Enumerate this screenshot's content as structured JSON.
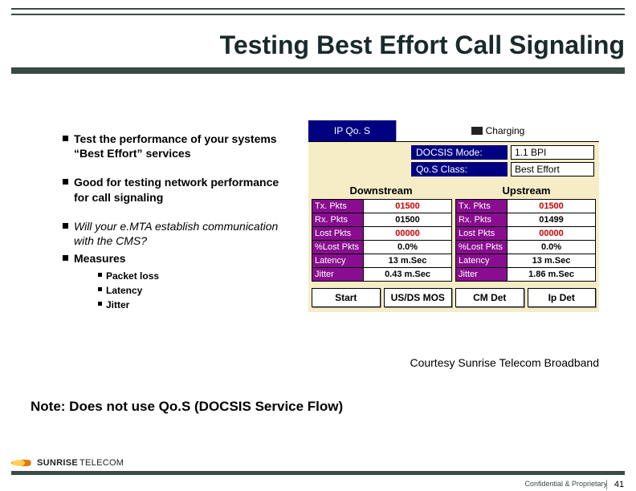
{
  "title": "Testing Best Effort Call Signaling",
  "bullets": {
    "b1": "Test the performance of your systems “Best Effort” services",
    "b2": "Good for testing network performance for call signaling",
    "b3": " Will your e.MTA establish communication with the CMS?",
    "b4": "Measures",
    "sub": {
      "s1": "Packet loss",
      "s2": "Latency",
      "s3": "Jitter"
    }
  },
  "panel": {
    "tab_left": "IP Qo. S",
    "tab_right": "Charging",
    "info": {
      "docsis_label": "DOCSIS Mode:",
      "docsis_value": "1.1  BPI",
      "qos_label": "Qo.S Class:",
      "qos_value": "Best Effort"
    },
    "headers": {
      "down": "Downstream",
      "up": "Upstream"
    },
    "rows_labels": {
      "tx": "Tx. Pkts",
      "rx": "Rx. Pkts",
      "lost": "Lost Pkts",
      "pct": "%Lost Pkts",
      "lat": "Latency",
      "jit": "Jitter"
    },
    "down_vals": {
      "tx": "01500",
      "rx": "01500",
      "lost": "00000",
      "pct": "0.0%",
      "lat": "13 m.Sec",
      "jit": "0.43 m.Sec"
    },
    "up_vals": {
      "tx": "01500",
      "rx": "01499",
      "lost": "00000",
      "pct": "0.0%",
      "lat": "13 m.Sec",
      "jit": "1.86 m.Sec"
    },
    "buttons": {
      "start": "Start",
      "usds": "US/DS MOS",
      "cmdet": "CM Det",
      "ipdet": "Ip Det"
    }
  },
  "courtesy": "Courtesy Sunrise Telecom Broadband",
  "note": "Note: Does not use Qo.S (DOCSIS Service Flow)",
  "footer": {
    "brand1": "SUNRISE",
    "brand2": "TELECOM",
    "conf": "Confidential & Proprietary",
    "page": "41"
  }
}
